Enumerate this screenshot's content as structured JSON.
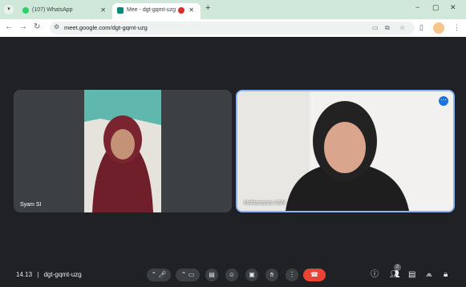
{
  "browser": {
    "tabs": [
      {
        "title": "(107) WhatsApp",
        "favicon": "whatsapp-icon",
        "active": false
      },
      {
        "title": "Mee - dgt-gqmt-uzg",
        "favicon": "meet-icon",
        "active": true,
        "recording": true
      }
    ],
    "new_tab": "+",
    "window_controls": {
      "minimize": "−",
      "restore": "▢",
      "close": "✕"
    },
    "nav": {
      "back": "←",
      "forward": "→",
      "reload": "↻"
    },
    "address": "meet.google.com/dgt-gqmt-uzg",
    "site_info_icon": "tune-icon"
  },
  "meet": {
    "participants": [
      {
        "name": "Syam SI",
        "is_self": false
      },
      {
        "name": "Nofitarianto ASN",
        "is_self": false,
        "speaking_highlight": true
      }
    ],
    "time": "14.13",
    "separator": "|",
    "meeting_code": "dgt-gqmt-uzg",
    "people_count": "2"
  },
  "colors": {
    "stage_bg": "#202124",
    "tab_strip": "#cfe8d9",
    "leave_button": "#ea4335",
    "active_speaker_border": "#8ab4f8"
  }
}
